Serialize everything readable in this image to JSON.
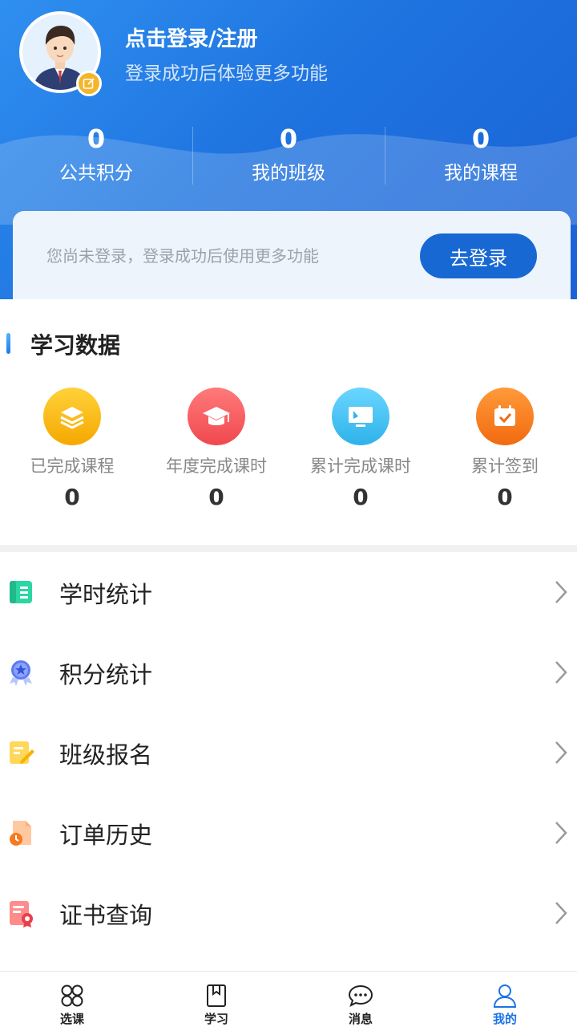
{
  "header": {
    "login_title": "点击登录/注册",
    "login_subtitle": "登录成功后体验更多功能",
    "stats": [
      {
        "value": "0",
        "label": "公共积分"
      },
      {
        "value": "0",
        "label": "我的班级"
      },
      {
        "value": "0",
        "label": "我的课程"
      }
    ]
  },
  "notice": {
    "text": "您尚未登录，登录成功后使用更多功能",
    "button_label": "去登录"
  },
  "learning": {
    "title": "学习数据",
    "items": [
      {
        "label": "已完成课程",
        "value": "0",
        "icon": "layers-icon",
        "color": "#f7b500"
      },
      {
        "label": "年度完成课时",
        "value": "0",
        "icon": "graduation-cap-icon",
        "color": "#f4595e"
      },
      {
        "label": "累计完成课时",
        "value": "0",
        "icon": "monitor-icon",
        "color": "#38bff0"
      },
      {
        "label": "累计签到",
        "value": "0",
        "icon": "calendar-check-icon",
        "color": "#f86d12"
      }
    ]
  },
  "menu": [
    {
      "label": "学时统计",
      "icon": "notebook-icon"
    },
    {
      "label": "积分统计",
      "icon": "medal-icon"
    },
    {
      "label": "班级报名",
      "icon": "edit-form-icon"
    },
    {
      "label": "订单历史",
      "icon": "order-clock-icon"
    },
    {
      "label": "证书查询",
      "icon": "certificate-icon"
    }
  ],
  "tabbar": {
    "active_color": "#1a73e8",
    "tabs": [
      {
        "label": "选课",
        "icon": "grid-icon"
      },
      {
        "label": "学习",
        "icon": "book-icon"
      },
      {
        "label": "消息",
        "icon": "chat-icon"
      },
      {
        "label": "我的",
        "icon": "person-icon"
      }
    ]
  }
}
